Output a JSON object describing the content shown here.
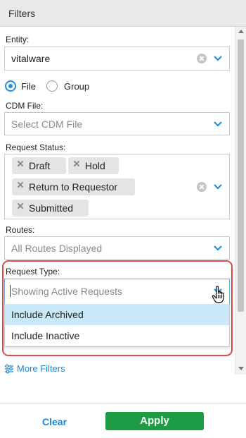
{
  "header": {
    "title": "Filters"
  },
  "entity": {
    "label": "Entity:",
    "value": "vitalware"
  },
  "scope": {
    "options": [
      {
        "label": "File",
        "selected": true
      },
      {
        "label": "Group",
        "selected": false
      }
    ]
  },
  "cdm_file": {
    "label": "CDM File:",
    "placeholder": "Select CDM File"
  },
  "request_status": {
    "label": "Request Status:",
    "tags": [
      "Draft",
      "Hold",
      "Return to Requestor",
      "Submitted"
    ]
  },
  "routes": {
    "label": "Routes:",
    "value": "All Routes Displayed"
  },
  "request_type": {
    "label": "Request Type:",
    "value": "Showing Active Requests",
    "options": [
      "Include Archived",
      "Include Inactive"
    ],
    "highlighted_option": "Include Archived"
  },
  "more_filters": {
    "label": "More Filters"
  },
  "footer": {
    "clear_label": "Clear",
    "apply_label": "Apply"
  },
  "colors": {
    "accent": "#1e8fe0",
    "link": "#1b87d6",
    "apply": "#1e9b45",
    "highlight": "#e0484a",
    "option_hover": "#c9e8fa"
  },
  "icons": [
    "chevron-down-icon",
    "clear-icon",
    "tag-remove-icon",
    "sliders-icon",
    "hand-cursor-icon"
  ]
}
